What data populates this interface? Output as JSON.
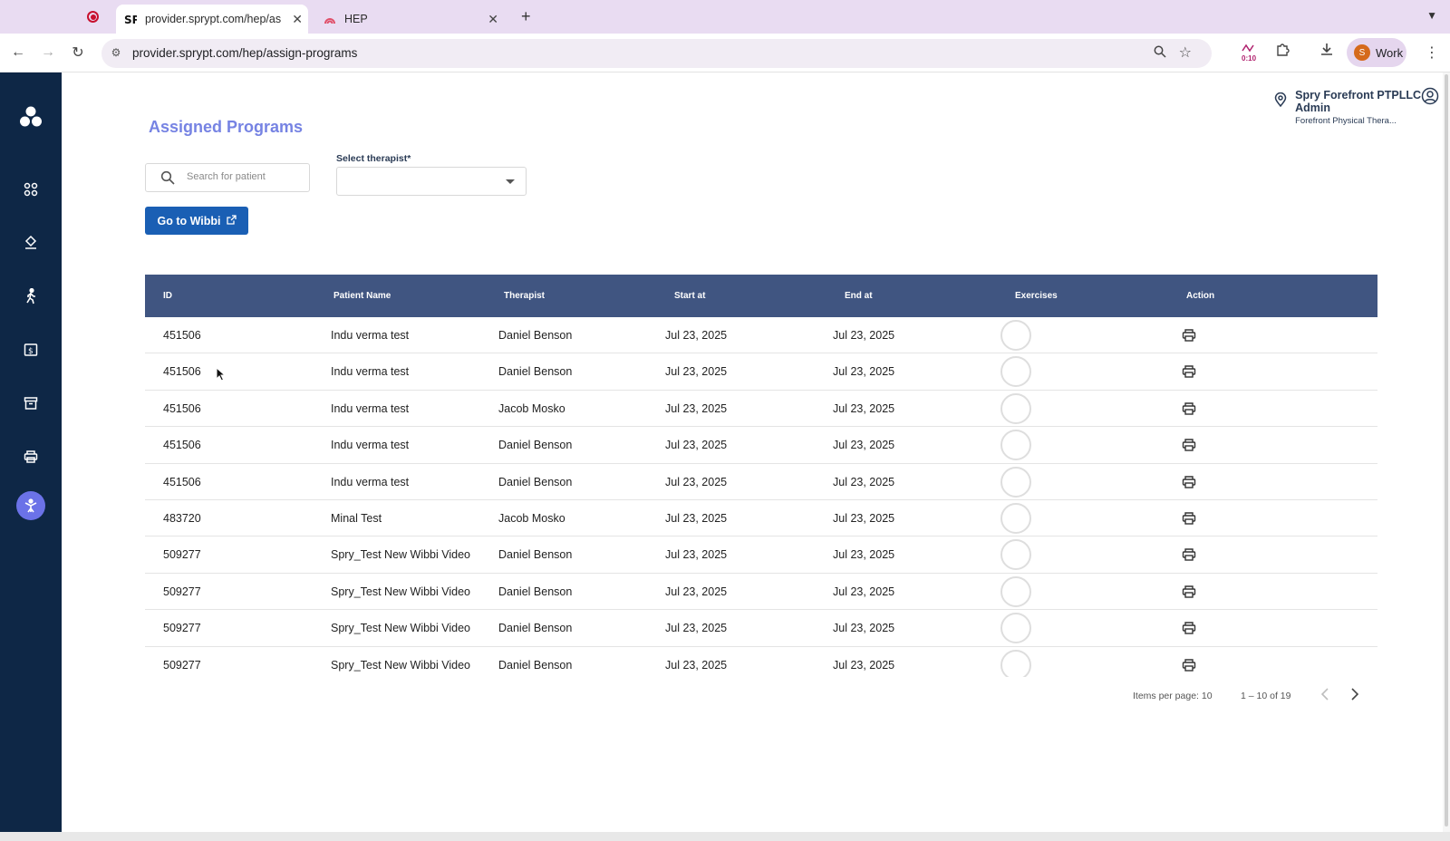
{
  "browser": {
    "tabs": [
      {
        "title": "provider.sprypt.com/hep/assi",
        "active": true
      },
      {
        "title": "HEP",
        "active": false
      }
    ],
    "url": "provider.sprypt.com/hep/assign-programs",
    "timer": "0:10",
    "profile_initial": "S",
    "profile_label": "Work"
  },
  "header": {
    "location_name": "Spry Forefront PTPLLC Admin",
    "location_sub": "Forefront Physical Thera..."
  },
  "sidebar": {
    "items": [
      "logo-icon",
      "apps-icon",
      "location-icon",
      "walking-icon",
      "billing-icon",
      "archive-icon",
      "print-icon",
      "exercise-icon"
    ]
  },
  "page": {
    "title": "Assigned Programs",
    "search_placeholder": "Search for patient",
    "select_label": "Select therapist*",
    "select_value": "",
    "wibbi_button": "Go to Wibbi"
  },
  "table": {
    "columns": [
      "ID",
      "Patient Name",
      "Therapist",
      "Start at",
      "End at",
      "Exercises",
      "Action"
    ],
    "rows": [
      {
        "id": "451506",
        "patient": "Indu verma test",
        "therapist": "Daniel Benson",
        "start": "Jul 23, 2025",
        "end": "Jul 23, 2025"
      },
      {
        "id": "451506",
        "patient": "Indu verma test",
        "therapist": "Daniel Benson",
        "start": "Jul 23, 2025",
        "end": "Jul 23, 2025"
      },
      {
        "id": "451506",
        "patient": "Indu verma test",
        "therapist": "Jacob Mosko",
        "start": "Jul 23, 2025",
        "end": "Jul 23, 2025"
      },
      {
        "id": "451506",
        "patient": "Indu verma test",
        "therapist": "Daniel Benson",
        "start": "Jul 23, 2025",
        "end": "Jul 23, 2025"
      },
      {
        "id": "451506",
        "patient": "Indu verma test",
        "therapist": "Daniel Benson",
        "start": "Jul 23, 2025",
        "end": "Jul 23, 2025"
      },
      {
        "id": "483720",
        "patient": "Minal Test",
        "therapist": "Jacob Mosko",
        "start": "Jul 23, 2025",
        "end": "Jul 23, 2025"
      },
      {
        "id": "509277",
        "patient": "Spry_Test New Wibbi Video",
        "therapist": "Daniel Benson",
        "start": "Jul 23, 2025",
        "end": "Jul 23, 2025"
      },
      {
        "id": "509277",
        "patient": "Spry_Test New Wibbi Video",
        "therapist": "Daniel Benson",
        "start": "Jul 23, 2025",
        "end": "Jul 23, 2025"
      },
      {
        "id": "509277",
        "patient": "Spry_Test New Wibbi Video",
        "therapist": "Daniel Benson",
        "start": "Jul 23, 2025",
        "end": "Jul 23, 2025"
      },
      {
        "id": "509277",
        "patient": "Spry_Test New Wibbi Video",
        "therapist": "Daniel Benson",
        "start": "Jul 23, 2025",
        "end": "Jul 23, 2025"
      }
    ]
  },
  "pagination": {
    "items_per_page": "Items per page: 10",
    "range": "1 – 10 of 19"
  },
  "colors": {
    "sidebar": "#0e2746",
    "table_header": "#405581",
    "primary_button": "#1a5fb4",
    "title": "#7683e3",
    "active_sidebar": "#6b72e8"
  }
}
